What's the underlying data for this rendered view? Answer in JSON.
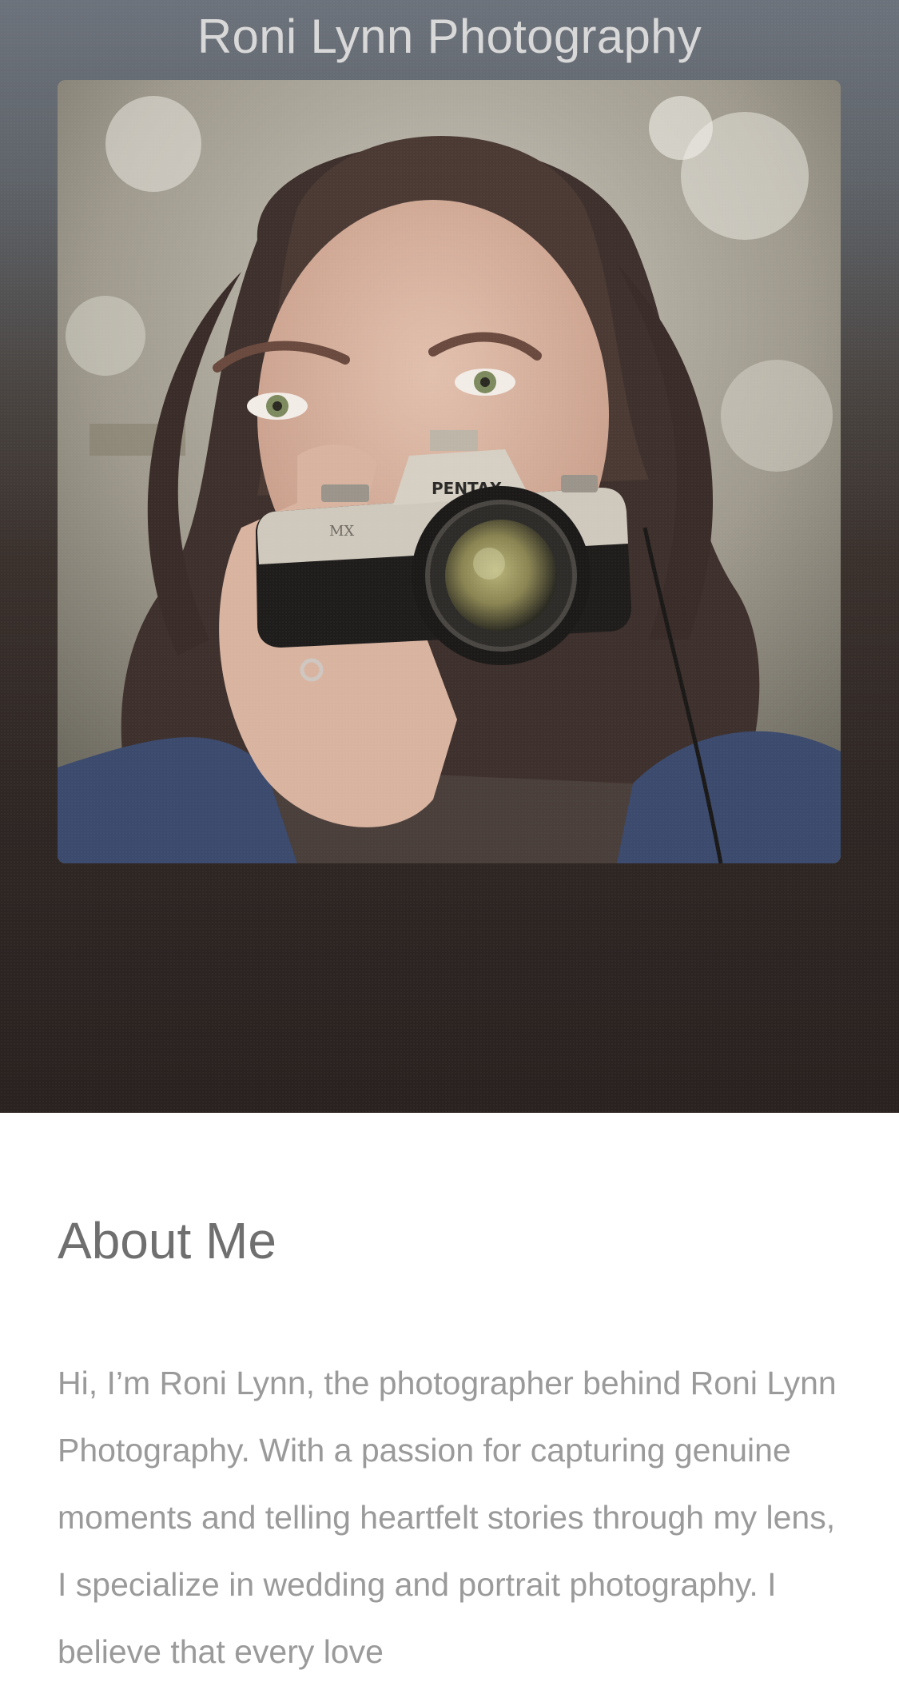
{
  "header": {
    "site_title": "Roni Lynn Photography"
  },
  "hero": {
    "photo_alt": "Woman holding a camera",
    "camera_brand": "PENTAX",
    "camera_model": "MX"
  },
  "about": {
    "heading": "About Me",
    "text": "Hi, I’m Roni Lynn, the photographer behind Roni Lynn Photography. With a passion for capturing genuine moments and telling heartfelt stories through my lens, I specialize in wedding and portrait photography. I believe that every love"
  },
  "colors": {
    "hero_top": "#6c727b",
    "hero_bottom": "#2a2220",
    "title_text": "#d8d8d8",
    "heading_text": "#6f6f6f",
    "body_text": "#9a9a9a"
  }
}
